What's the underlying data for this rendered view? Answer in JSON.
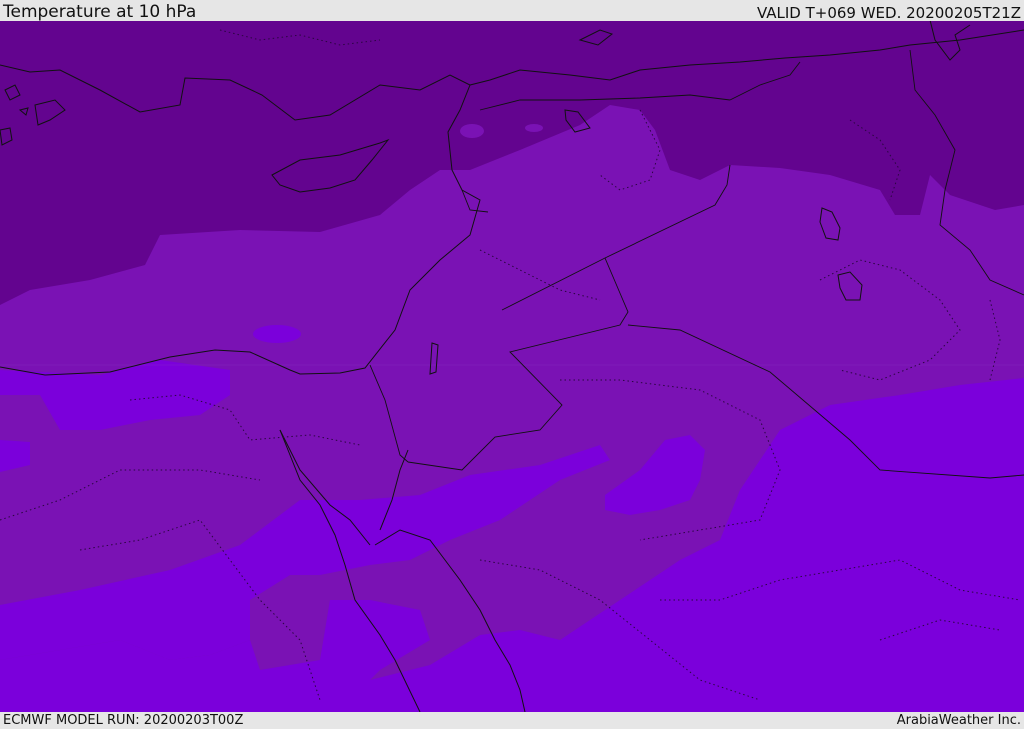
{
  "header": {
    "title": "Temperature at 10 hPa",
    "valid": "VALID T+069 WED. 20200205T21Z"
  },
  "footer": {
    "model_run": "ECMWF MODEL RUN: 20200203T00Z",
    "credit": "ArabiaWeather Inc."
  },
  "map": {
    "field": "temperature",
    "level": "10 hPa",
    "colors": {
      "coldest_band": "#63048f",
      "middle_band": "#7a12b4",
      "warmest_band": "#7b00db",
      "coastline": "#111111",
      "border": "#111111"
    }
  }
}
